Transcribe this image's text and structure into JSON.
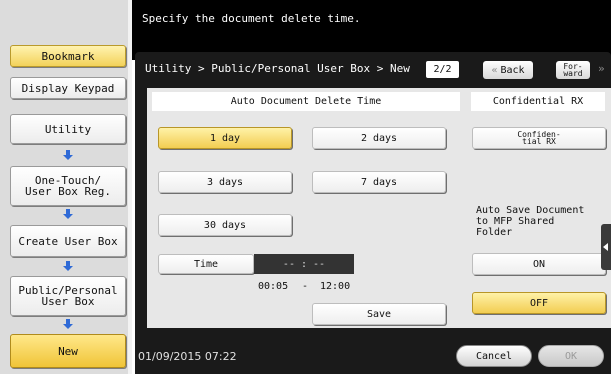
{
  "header": {
    "message": "Specify the document delete time."
  },
  "sidebar": {
    "bookmark": "Bookmark",
    "display_keypad": "Display Keypad",
    "steps": [
      {
        "label": "Utility"
      },
      {
        "label": "One-Touch/\nUser Box Reg."
      },
      {
        "label": "Create User Box"
      },
      {
        "label": "Public/Personal\nUser Box"
      },
      {
        "label": "New"
      }
    ]
  },
  "breadcrumb": "Utility > Public/Personal User Box > New",
  "pager": {
    "current": "2/2",
    "back_label": "Back",
    "forward_label": "For-\nward"
  },
  "delete_time": {
    "title": "Auto Document Delete Time",
    "options": [
      "1 day",
      "2 days",
      "3 days",
      "7 days",
      "30 days"
    ],
    "selected": "1 day",
    "time_label": "Time",
    "time_value": "-- : --",
    "range_min": "00:05",
    "range_sep": "-",
    "range_max": "12:00",
    "save_label": "Save"
  },
  "confidential": {
    "title": "Confidential RX",
    "button_label": "Confiden-\ntial RX",
    "auto_save_text": "Auto Save Document\nto MFP Shared Folder",
    "on_label": "ON",
    "off_label": "OFF",
    "selected": "OFF"
  },
  "footer": {
    "datetime": "01/09/2015  07:22",
    "cancel_label": "Cancel",
    "ok_label": "OK"
  },
  "colors": {
    "selected": "#f2cd52",
    "flow_arrow": "#2f6ad6",
    "panel": "#1a1a1a"
  }
}
